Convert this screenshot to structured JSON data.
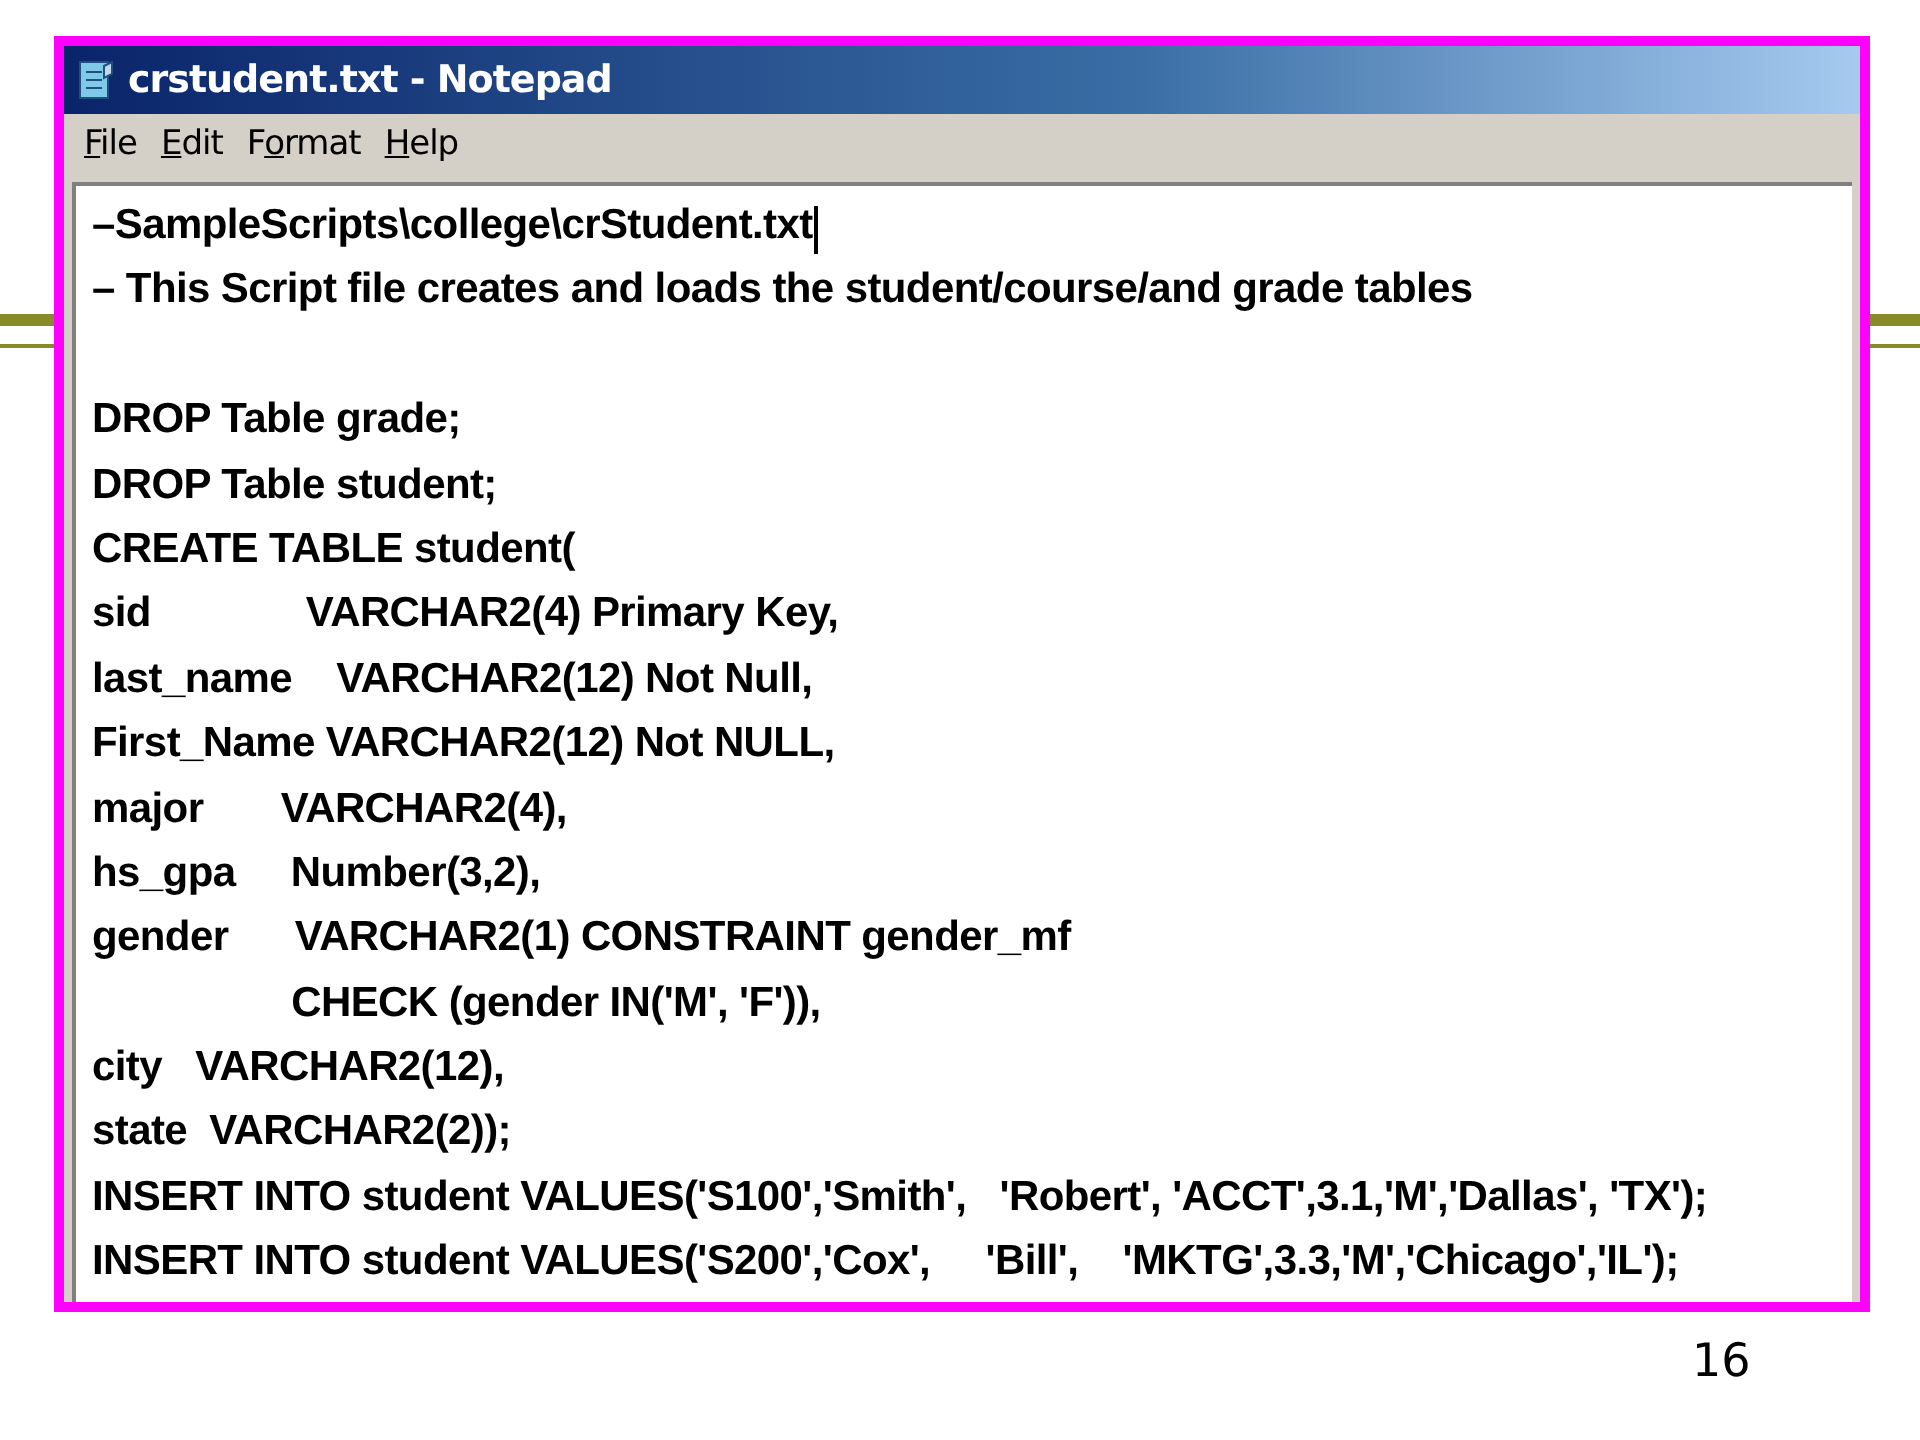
{
  "window": {
    "title": "crstudent.txt - Notepad"
  },
  "menu": [
    {
      "label": "**F**ile"
    },
    {
      "label": "**E**dit"
    },
    {
      "label": "F**o**rmat"
    },
    {
      "label": "**H**elp"
    }
  ],
  "editor": {
    "blocks": [
      {
        "lines": [
          "–SampleScripts\\college\\crStudent.txt",
          "– This Script file creates and loads the student/course/and grade tables"
        ]
      },
      {
        "lines": [
          "DROP Table grade;",
          "DROP Table student;",
          "CREATE TABLE student(",
          "sid              VARCHAR2(4) Primary Key,",
          "last_name    VARCHAR2(12) Not Null,",
          "First_Name VARCHAR2(12) Not NULL,",
          "major       VARCHAR2(4),",
          "hs_gpa     Number(3,2),",
          "gender      VARCHAR2(1) CONSTRAINT gender_mf",
          "                  CHECK (gender IN('M', 'F')),",
          "city   VARCHAR2(12),",
          "state  VARCHAR2(2));",
          "INSERT INTO student VALUES('S100','Smith',   'Robert', 'ACCT',3.1,'M','Dallas', 'TX');",
          "INSERT INTO student VALUES('S200','Cox',     'Bill',    'MKTG',3.3,'M','Chicago','IL');"
        ]
      }
    ]
  },
  "slide_number": "16"
}
